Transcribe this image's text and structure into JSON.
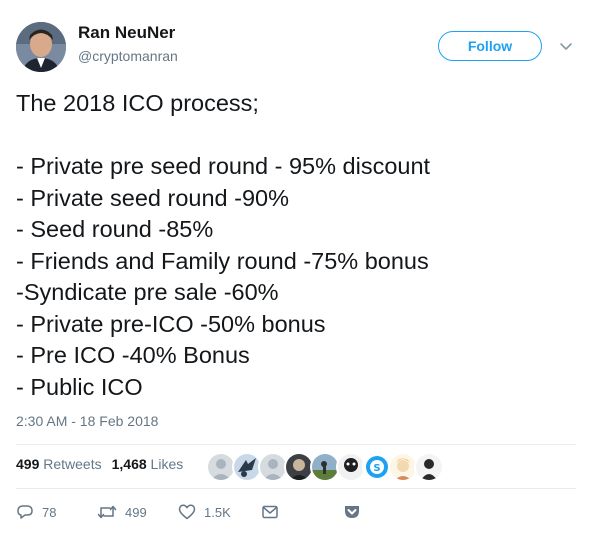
{
  "author": {
    "name": "Ran NeuNer",
    "handle": "@cryptomanran"
  },
  "follow_label": "Follow",
  "tweet": {
    "lines": [
      "The 2018 ICO process;",
      "",
      "- Private pre seed round - 95% discount",
      "- Private seed round -90%",
      "- Seed round -85%",
      "- Friends and Family round -75% bonus",
      "-Syndicate pre sale -60%",
      "- Private pre-ICO -50% bonus",
      "- Pre ICO -40% Bonus",
      "- Public ICO"
    ],
    "timestamp": "2:30 AM - 18 Feb 2018"
  },
  "stats": {
    "retweets_count": "499",
    "retweets_label": "Retweets",
    "likes_count": "1,468",
    "likes_label": "Likes"
  },
  "actions": {
    "reply_count": "78",
    "retweet_count": "499",
    "like_count": "1.5K"
  },
  "colors": {
    "accent": "#1da1f2",
    "text": "#14171a",
    "secondary": "#657786",
    "divider": "#e6ecf0"
  },
  "icons": [
    "chevron-down-icon",
    "reply-icon",
    "retweet-icon",
    "heart-icon",
    "mail-icon",
    "pocket-icon"
  ]
}
